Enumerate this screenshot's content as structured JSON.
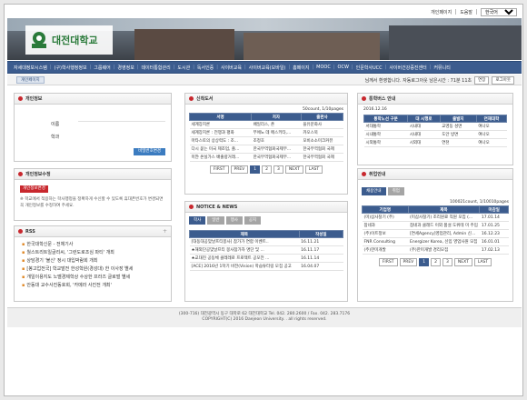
{
  "util": {
    "mypage": "개인페이지",
    "help": "도움말",
    "language": "한국어"
  },
  "logo": {
    "text": "대전대학교"
  },
  "nav": [
    "자세대정보시스템",
    "(구)학사행정정보",
    "그룹웨어",
    "경영정보",
    "데이터통합관리",
    "도시관",
    "독서인증",
    "사이버교육",
    "사이버교육(모바일)",
    "홈페이지",
    "MOOC",
    "OCW",
    "인문학사UCC",
    "사이버건강증진센터",
    "커뮤니티"
  ],
  "subbar": {
    "myinfo": "개인페이지",
    "welcome": "님께서 환영합니다. 자동로그아웃 남은시간 : 71분 11초",
    "extend": "연장",
    "logout": "로그아웃"
  },
  "personal": {
    "title": "개인정보",
    "name_label": "이름",
    "dept_label": "학과",
    "change_btn": "비밀번호변경"
  },
  "privacy": {
    "title": "개인정보수정",
    "badge": "개인정보변경",
    "note": "※ 학교에서 적용하는 학사행정을 정확하게 수신할 수 있도록 휴대폰번호가 변경되면 꼭 개인정보를 수정하여 주세요."
  },
  "rss": {
    "title": "RSS",
    "items": [
      "한국대학신문 - 전체기사",
      "월스트리트일글리씨, '그런도로조심 파티' 개최",
      "상담경기 '불신' 정시 대입박람회 개최",
      "[봉고업전국] 학교발전 한성학원(경성대) 한 이사장 별세",
      "개일이용지도 노벨경제학상 수상한 프라즈 글로벌 별세",
      "안동대 교수사진동호회, '카메라 사진전 개최'"
    ]
  },
  "books": {
    "title": "신착도서",
    "count": "50count, 1/10pages",
    "headers": [
      "서명",
      "저자",
      "출판사"
    ],
    "rows": [
      [
        "세계장치론",
        "배일리스, 존",
        "을유문화사"
      ],
      [
        "세계장치론 : 전쟁과 평화",
        "부에노 데 메스키타,...",
        "카오스북"
      ],
      [
        "마타스토의 상상력도 : 조...",
        "조정호",
        "모비소소미크커뮤"
      ],
      [
        "다시 묻는 미국 제조업, 즐...",
        "한국무역협회국제무...",
        "한국무역협회 국제"
      ],
      [
        "미얀 온실가스 배출량거래...",
        "한국무역협회국제무...",
        "한국무역협회 국제"
      ]
    ],
    "pager": [
      "FIRST",
      "PREV",
      "1",
      "2",
      "3",
      "NEXT",
      "LAST"
    ]
  },
  "notice": {
    "title": "NOTICE & NEWS",
    "tabs": [
      "학사",
      "일반",
      "행사",
      "공지"
    ],
    "headers": [
      "제목",
      "작성일"
    ],
    "rows": [
      [
        "[대동대공맞날프티봉사] 참가가 연합 이벤트..",
        "16.11.21"
      ],
      [
        "★해외단공맞날프티 봉사참가자 명단 및 ...",
        "16.11.17"
      ],
      [
        "★교대진 공동체 클레레로 프로젝트 공모전 ...",
        "16.11.14"
      ],
      [
        "[ACE] 2016년 1학기 비전(Vision) 학습튜터링 모집 공고",
        "16.04.07"
      ]
    ]
  },
  "library": {
    "title": "통학버스 안내",
    "date": "2016.12.16",
    "headers": [
      "통학노선 구분",
      "대 시행로",
      "출발지",
      "연재대학"
    ],
    "rows": [
      [
        "서대통학",
        "시내대",
        "교영동 성면",
        "여나오"
      ],
      [
        "시내통학",
        "시내대",
        "도안 방면",
        "여나오"
      ],
      [
        "시외통학",
        "시외대",
        "연천",
        "여나오"
      ]
    ]
  },
  "jobs": {
    "title": "취업안내",
    "tabs": [
      "채용안내",
      "취업"
    ],
    "count": "100021count, 1/10010pages",
    "headers": [
      "기업명",
      "제목",
      "마감일"
    ],
    "rows": [
      [
        "(미)삼사찰기 (주)",
        "(미삼사찰기) 조리원료 직원 모집 (...",
        "17.01.14"
      ],
      [
        "참네과",
        "참네과 클래드 이외 품설 도위테 미 주입",
        "17.01.25"
      ],
      [
        "(주)이트정보",
        "[연세Agency]영업관리, Admin 신입 모집",
        "16.12.23"
      ],
      [
        "FNR Consulting",
        "Energizer Korea, 신입 영업사원 모집",
        "16.01.01"
      ],
      [
        "(주)한미개발",
        "(주)한미개발 경리모집",
        "17.02.13"
      ]
    ],
    "pager": [
      "FIRST",
      "PREV",
      "1",
      "2",
      "3",
      "NEXT",
      "LAST"
    ]
  },
  "footer": {
    "line1": "(300-716) 대전광역시 동구 대학로 62 대전대학교    Tel. 042. 280.2600  /  Fax. 042. 283.7176",
    "line2": "COPYRIGHT(C) 2016 Daejeon University. . all rights reserved."
  }
}
